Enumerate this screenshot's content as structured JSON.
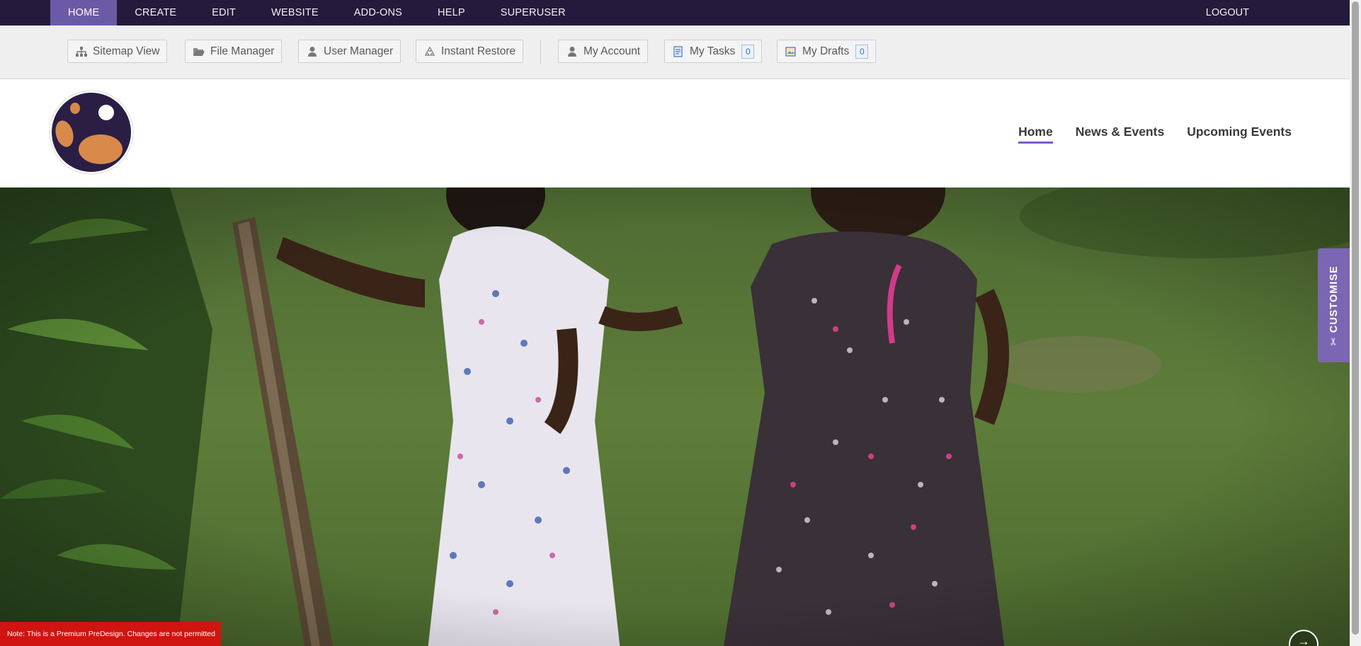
{
  "admin_bar": {
    "menu": [
      {
        "label": "HOME",
        "active": true
      },
      {
        "label": "CREATE"
      },
      {
        "label": "EDIT"
      },
      {
        "label": "WEBSITE"
      },
      {
        "label": "ADD-ONS"
      },
      {
        "label": "HELP"
      },
      {
        "label": "SUPERUSER"
      }
    ],
    "logout_label": "LOGOUT",
    "background_color": "#241a3b",
    "active_color": "#6b5aa6"
  },
  "toolbar": {
    "sitemap_label": "Sitemap View",
    "file_manager_label": "File Manager",
    "user_manager_label": "User Manager",
    "instant_restore_label": "Instant Restore",
    "my_account_label": "My Account",
    "my_tasks_label": "My Tasks",
    "my_tasks_count": "0",
    "my_drafts_label": "My Drafts",
    "my_drafts_count": "0"
  },
  "site_header": {
    "nav": [
      {
        "label": "Home",
        "active": true
      },
      {
        "label": "News & Events"
      },
      {
        "label": "Upcoming Events"
      }
    ],
    "accent_color": "#7b5cc8",
    "logo_icon": "planet-logo"
  },
  "hero": {
    "image": "two-children-holding-hands-walking-on-grass"
  },
  "customise": {
    "label": "CUSTOMISE",
    "icon": "scissors-icon",
    "color": "#7b66b3"
  },
  "notice": {
    "text": "Note: This is a Premium PreDesign. Changes are not permitted",
    "color": "#d0140f"
  }
}
